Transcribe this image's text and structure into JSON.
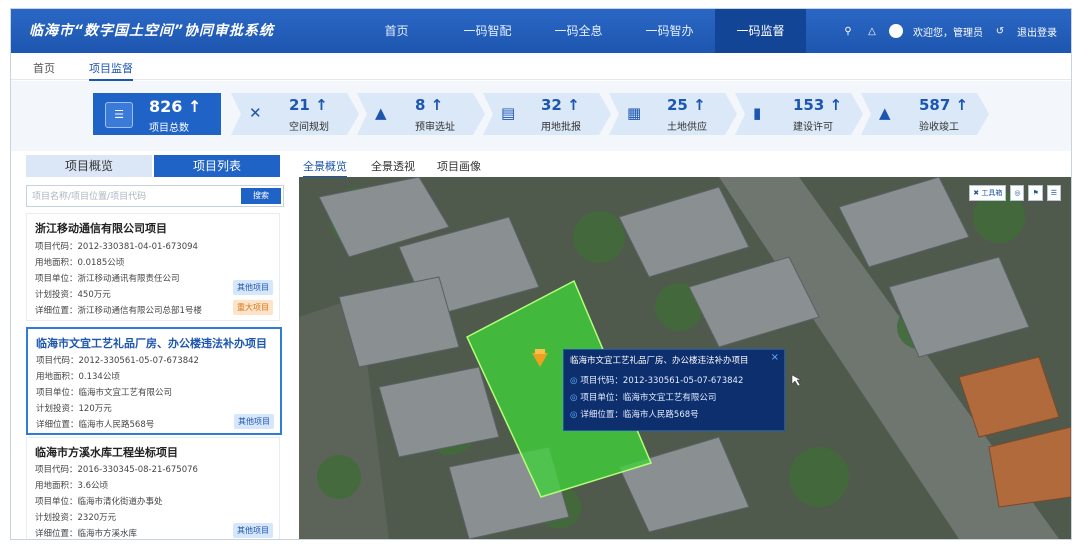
{
  "header": {
    "title": "临海市“数字国土空间”协同审批系统",
    "nav": [
      "首页",
      "一码智配",
      "一码全息",
      "一码智办",
      "一码监督"
    ],
    "active_nav": "一码监督",
    "welcome": "欢迎您，管理员",
    "logout": "退出登录"
  },
  "breadcrumbs": [
    "首页",
    "项目监督"
  ],
  "stats": {
    "total": {
      "value": "826 ↑",
      "label": "项目总数"
    },
    "items": [
      {
        "value": "21 ↑",
        "label": "空间规划",
        "icon": "✕"
      },
      {
        "value": "8 ↑",
        "label": "预审选址",
        "icon": "▲"
      },
      {
        "value": "32 ↑",
        "label": "用地批报",
        "icon": "▤"
      },
      {
        "value": "25 ↑",
        "label": "土地供应",
        "icon": "▦"
      },
      {
        "value": "153 ↑",
        "label": "建设许可",
        "icon": "▮"
      },
      {
        "value": "587 ↑",
        "label": "验收竣工",
        "icon": "▲"
      }
    ]
  },
  "left": {
    "tabs": [
      "项目概览",
      "项目列表"
    ],
    "search_placeholder": "项目名称/项目位置/项目代码",
    "search_button": "搜索",
    "projects": [
      {
        "title": "浙江移动通信有限公司项目",
        "code": "项目代码：2012-330381-04-01-673094",
        "area": "用地面积：0.0185公顷",
        "unit": "项目单位：浙江移动通讯有限责任公司",
        "invest": "计划投资：450万元",
        "addr": "详细位置：浙江移动通信有限公司总部1号楼",
        "badges": [
          "其他项目",
          "重大项目"
        ]
      },
      {
        "title": "临海市文宜工艺礼品厂房、办公楼违法补办项目",
        "code": "项目代码：2012-330561-05-07-673842",
        "area": "用地面积：0.134公顷",
        "unit": "项目单位：临海市文宜工艺有限公司",
        "invest": "计划投资：120万元",
        "addr": "详细位置：临海市人民路568号",
        "badges": [
          "其他项目"
        ]
      },
      {
        "title": "临海市方溪水库工程坐标项目",
        "code": "项目代码：2016-330345-08-21-675076",
        "area": "用地面积：3.6公顷",
        "unit": "项目单位：临海市清化街道办事处",
        "invest": "计划投资：2320万元",
        "addr": "详细位置：临海市方溪水库",
        "badges": [
          "其他项目"
        ]
      }
    ]
  },
  "map": {
    "tabs": [
      "全景概览",
      "全景透视",
      "项目画像"
    ],
    "toolbox": "工具箱",
    "popup": {
      "title": "临海市文宜工艺礼品厂房、办公楼违法补办项目",
      "close": "×",
      "rows": [
        "项目代码：2012-330561-05-07-673842",
        "项目单位：临海市文宜工艺有限公司",
        "详细位置：临海市人民路568号"
      ]
    },
    "colors": {
      "parcel": "#3fd23a",
      "popup_bg": "#0d2f6e",
      "accent": "#1f63c6"
    }
  }
}
